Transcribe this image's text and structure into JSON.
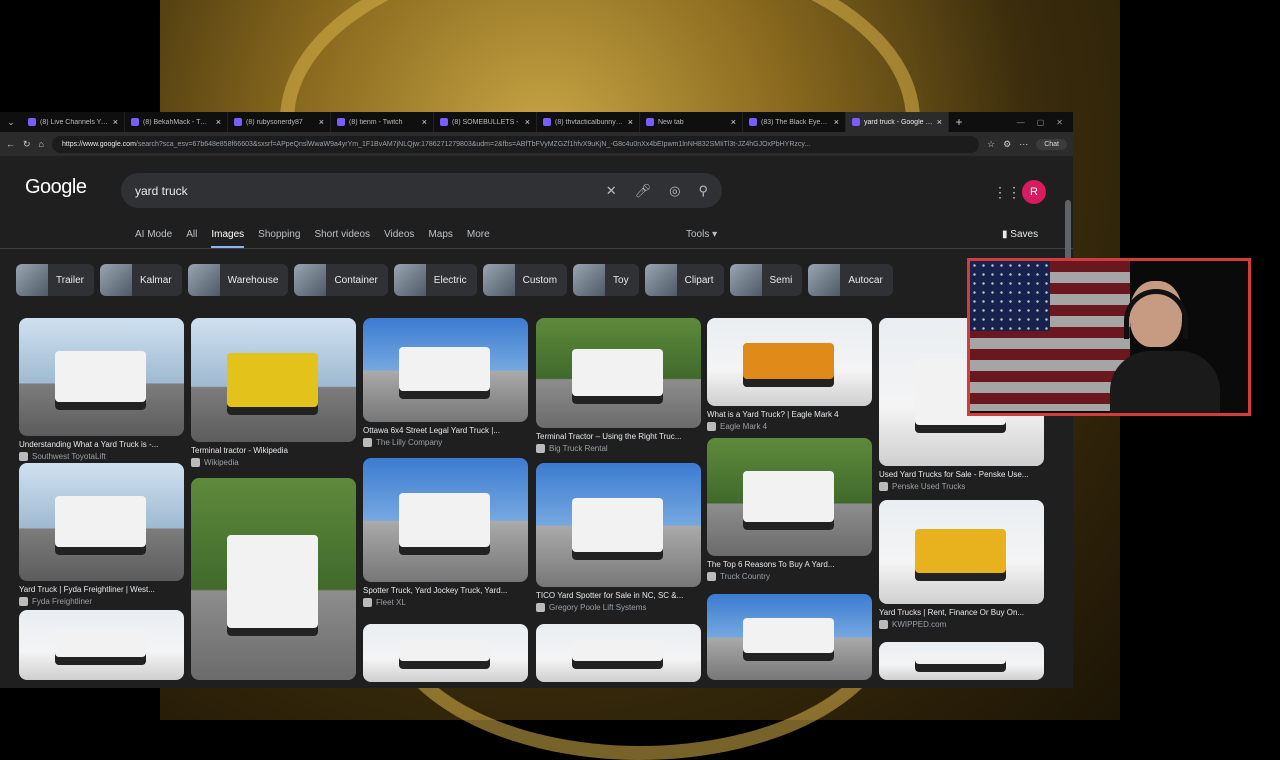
{
  "browser": {
    "tabs": [
      {
        "label": "(8) Live Channels You F...",
        "active": false
      },
      {
        "label": "(8) BekahMack - Twitch",
        "active": false
      },
      {
        "label": "(8) rubysonerdy87",
        "active": false
      },
      {
        "label": "(8) tienm - Twitch",
        "active": false
      },
      {
        "label": "(8) SOMEBULLETS -",
        "active": false
      },
      {
        "label": "(8) thvtacticalbunny - Tw...",
        "active": false
      },
      {
        "label": "New tab",
        "active": false
      },
      {
        "label": "(83) The Black Eyed Pe...",
        "active": false
      },
      {
        "label": "yard truck - Google Sea...",
        "active": true
      }
    ],
    "url_host": "https://www.google.com",
    "url_rest": "/search?sca_esv=67b648e858f66603&sxsrf=APpeQnslWwaW9a4yrYm_1F1BvAM7jNLQjw:1786271279803&udm=2&fbs=ABfTbFVyMZGZf1hfvX9uKjN_-G8c4u0nXx4bEIpwm1lnNH832SMIiTl3t-JZ4hGJOxPbHYRzcy...",
    "chat_label": "Chat"
  },
  "google": {
    "logo": "Google",
    "query": "yard truck",
    "avatar_letter": "R",
    "nav_tabs": [
      "AI Mode",
      "All",
      "Images",
      "Shopping",
      "Short videos",
      "Videos",
      "Maps",
      "More"
    ],
    "active_tab": "Images",
    "tools_label": "Tools",
    "saves_label": "Saves",
    "chips": [
      "Trailer",
      "Kalmar",
      "Warehouse",
      "Container",
      "Electric",
      "Custom",
      "Toy",
      "Clipart",
      "Semi",
      "Autocar"
    ]
  },
  "results": [
    {
      "caption": "Understanding What a Yard Truck is -...",
      "source": "Southwest ToyotaLift"
    },
    {
      "caption": "Yard Truck | Fyda Freightliner | West...",
      "source": "Fyda Freightliner"
    },
    {
      "caption": "Terminal tractor - Wikipedia",
      "source": "Wikipedia"
    },
    {
      "caption": "Ottawa 6x4 Street Legal Yard Truck |...",
      "source": "The Lilly Company"
    },
    {
      "caption": "Spotter Truck, Yard Jockey Truck, Yard...",
      "source": "Fleet XL"
    },
    {
      "caption": "Terminal Tractor – Using the Right Truc...",
      "source": "Big Truck Rental"
    },
    {
      "caption": "TICO Yard Spotter for Sale in NC, SC &...",
      "source": "Gregory Poole Lift Systems"
    },
    {
      "caption": "What is a Yard Truck? | Eagle Mark 4",
      "source": "Eagle Mark 4"
    },
    {
      "caption": "The Top 6 Reasons To Buy A Yard...",
      "source": "Truck Country"
    },
    {
      "caption": "Used Yard Trucks for Sale - Penske Use...",
      "source": "Penske Used Trucks"
    },
    {
      "caption": "Yard Trucks | Rent, Finance Or Buy On...",
      "source": "KWIPPED.com"
    }
  ],
  "colors": {
    "accent": "#8ab4f8",
    "avatar": "#d81b60",
    "webcam_border": "#d43c3c"
  }
}
